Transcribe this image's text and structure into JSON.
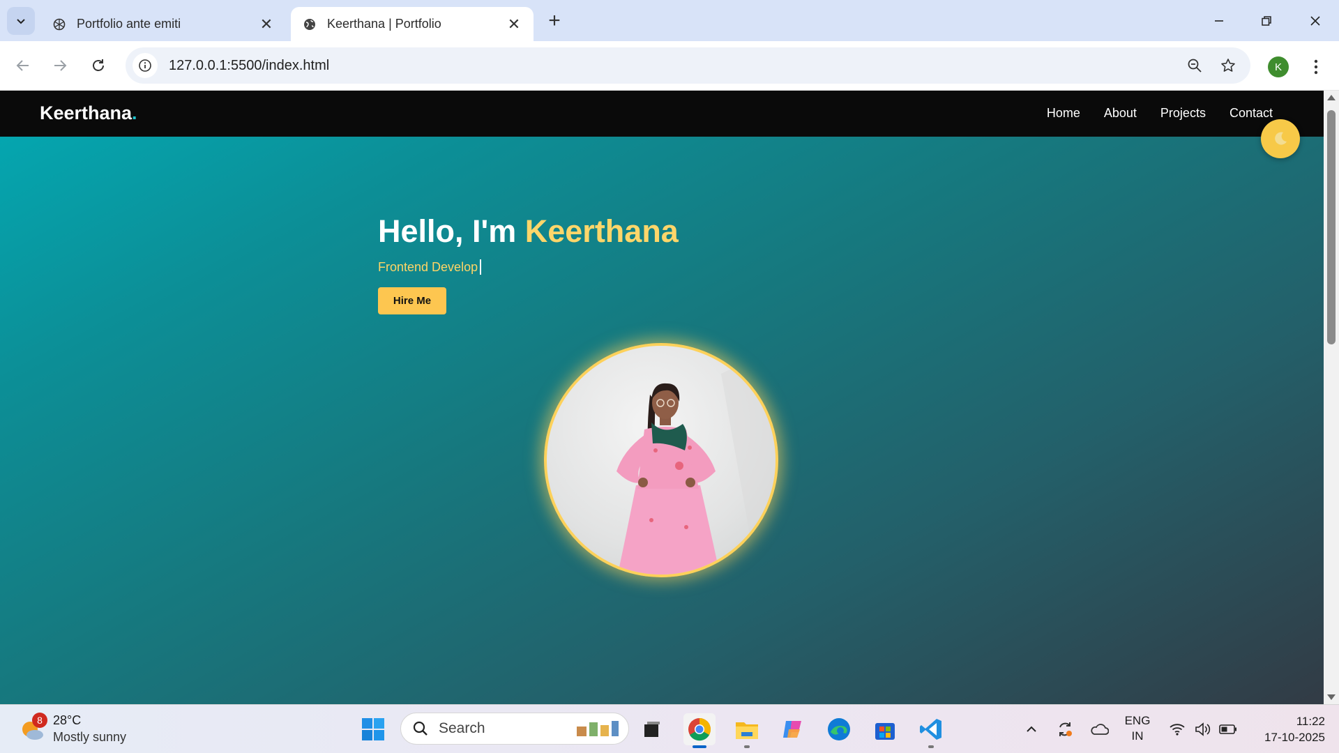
{
  "browser": {
    "tabs": [
      {
        "title": "Portfolio ante emiti",
        "active": false
      },
      {
        "title": "Keerthana | Portfolio",
        "active": true
      }
    ],
    "url": "127.0.0.1:5500/index.html",
    "profile_initial": "K"
  },
  "site": {
    "logo_text": "Keerthana",
    "logo_dot": ".",
    "nav": [
      "Home",
      "About",
      "Projects",
      "Contact"
    ],
    "hero": {
      "greeting": "Hello, I'm ",
      "name": "Keerthana",
      "subtitle": "Frontend Develop",
      "cta": "Hire Me"
    }
  },
  "taskbar": {
    "weather": {
      "badge": "8",
      "temp": "28°C",
      "condition": "Mostly sunny"
    },
    "search_label": "Search",
    "language": {
      "line1": "ENG",
      "line2": "IN"
    },
    "clock": {
      "time": "11:22",
      "date": "17-10-2025"
    }
  },
  "colors": {
    "accent": "#fdd66a",
    "button": "#fdc650",
    "logo_dot": "#20c4cf",
    "nav_bg": "#0a0a0a"
  }
}
